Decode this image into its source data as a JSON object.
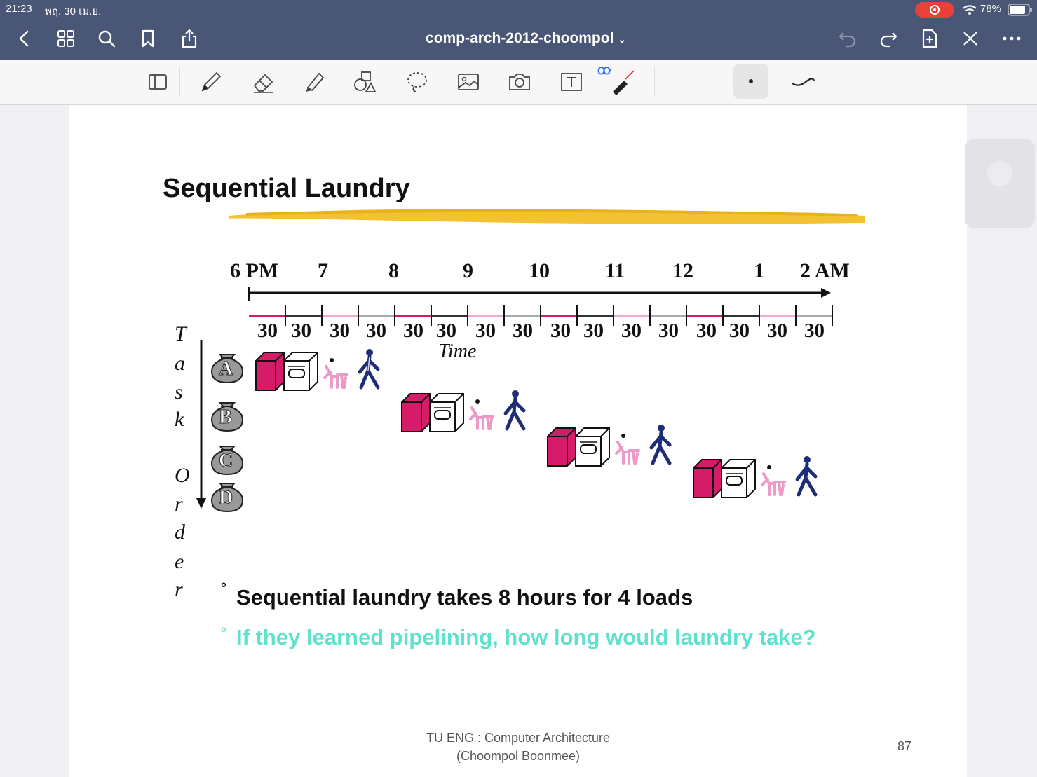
{
  "status_bar": {
    "time": "21:23",
    "date": "พฤ. 30 เม.ย.",
    "battery": "78%"
  },
  "nav": {
    "title": "comp-arch-2012-choompol"
  },
  "slide": {
    "title": "Sequential Laundry",
    "time_labels": [
      "6 PM",
      "7",
      "8",
      "9",
      "10",
      "11",
      "12",
      "1",
      "2 AM"
    ],
    "segment_label": "30",
    "time_word": "Time",
    "task_order": [
      "T",
      "a",
      "s",
      "k",
      "O",
      "r",
      "d",
      "e",
      "r"
    ],
    "tasks": [
      "A",
      "B",
      "C",
      "D"
    ],
    "bullet1": "Sequential laundry takes 8 hours for 4 loads",
    "bullet2": "If they learned pipelining, how long would  laundry take?",
    "footer_line1": "TU ENG : Computer Architecture",
    "footer_line2": "(Choompol Boonmee)",
    "page_number": "87"
  },
  "colors": {
    "accent_bar": "#f2c233",
    "washer": "#d61c69",
    "folder": "#ee9ac8",
    "walker": "#1f2d77",
    "question": "#5ee1ce"
  }
}
